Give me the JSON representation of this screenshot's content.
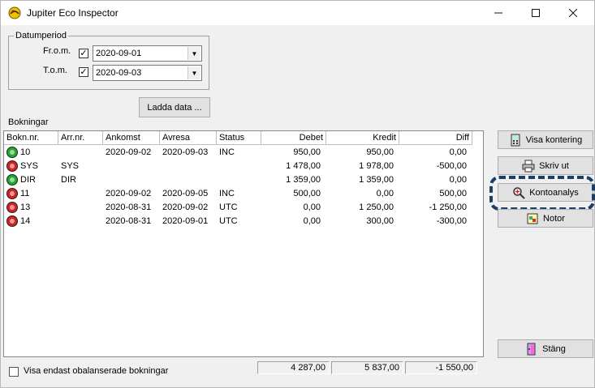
{
  "window": {
    "title": "Jupiter Eco Inspector",
    "minimize": "—",
    "maximize": "☐",
    "close": "✕"
  },
  "period": {
    "legend": "Datumperiod",
    "from_label": "Fr.o.m.",
    "from_checked": "✓",
    "from_value": "2020-09-01",
    "to_label": "T.o.m.",
    "to_checked": "✓",
    "to_value": "2020-09-03"
  },
  "load_button": "Ladda data ...",
  "bookings_label": "Bokningar",
  "columns": [
    "Bokn.nr.",
    "Arr.nr.",
    "Ankomst",
    "Avresa",
    "Status",
    "Debet",
    "Kredit",
    "Diff"
  ],
  "rows": [
    {
      "status_color": "green",
      "bokn": "10",
      "arr": "",
      "ankomst": "2020-09-02",
      "avresa": "2020-09-03",
      "status": "INC",
      "debet": "950,00",
      "kredit": "950,00",
      "diff": "0,00"
    },
    {
      "status_color": "red",
      "bokn": "SYS",
      "arr": "SYS",
      "ankomst": "",
      "avresa": "",
      "status": "",
      "debet": "1 478,00",
      "kredit": "1 978,00",
      "diff": "-500,00"
    },
    {
      "status_color": "green",
      "bokn": "DIR",
      "arr": "DIR",
      "ankomst": "",
      "avresa": "",
      "status": "",
      "debet": "1 359,00",
      "kredit": "1 359,00",
      "diff": "0,00"
    },
    {
      "status_color": "red",
      "bokn": "11",
      "arr": "",
      "ankomst": "2020-09-02",
      "avresa": "2020-09-05",
      "status": "INC",
      "debet": "500,00",
      "kredit": "0,00",
      "diff": "500,00"
    },
    {
      "status_color": "red",
      "bokn": "13",
      "arr": "",
      "ankomst": "2020-08-31",
      "avresa": "2020-09-02",
      "status": "UTC",
      "debet": "0,00",
      "kredit": "1 250,00",
      "diff": "-1 250,00"
    },
    {
      "status_color": "red",
      "bokn": "14",
      "arr": "",
      "ankomst": "2020-08-31",
      "avresa": "2020-09-01",
      "status": "UTC",
      "debet": "0,00",
      "kredit": "300,00",
      "diff": "-300,00"
    }
  ],
  "side_buttons": {
    "visa_kontering": "Visa kontering",
    "skriv_ut": "Skriv ut",
    "kontoanalys": "Kontoanalys",
    "notor": "Notor",
    "stang": "Stäng"
  },
  "only_unbalanced_label": "Visa endast obalanserade bokningar",
  "totals": {
    "debet": "4 287,00",
    "kredit": "5 837,00",
    "diff": "-1 550,00"
  },
  "colors": {
    "green_status": "#1faa2e",
    "red_status": "#d42020",
    "focus_ring": "#1b3f66"
  }
}
